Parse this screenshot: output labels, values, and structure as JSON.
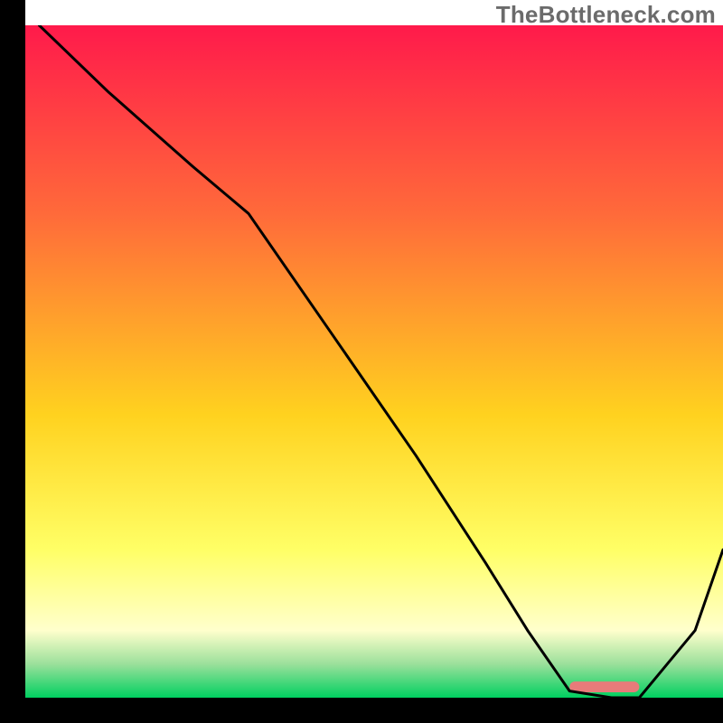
{
  "watermark": "TheBottleneck.com",
  "colors": {
    "grad_top": "#ff1a4b",
    "grad_mid1": "#ff6a3a",
    "grad_mid2": "#ffd21f",
    "grad_mid3": "#ffff66",
    "grad_mid4": "#ffffcc",
    "grad_green1": "#9be09b",
    "grad_green2": "#00d060",
    "axis": "#000000",
    "curve": "#000000",
    "marker": "#e77b7a"
  },
  "chart_data": {
    "type": "line",
    "title": "",
    "xlabel": "",
    "ylabel": "",
    "xlim": [
      0,
      100
    ],
    "ylim": [
      0,
      100
    ],
    "annotations": [],
    "series": [
      {
        "name": "curve",
        "x": [
          2,
          12,
          24,
          32,
          44,
          56,
          66,
          72,
          78,
          84,
          88,
          96,
          100
        ],
        "y": [
          100,
          90,
          79,
          72,
          54,
          36,
          20,
          10,
          1,
          0,
          0,
          10,
          22
        ]
      }
    ],
    "marker": {
      "x_start": 78,
      "x_end": 88,
      "y": 0.8,
      "height": 1.6
    }
  }
}
